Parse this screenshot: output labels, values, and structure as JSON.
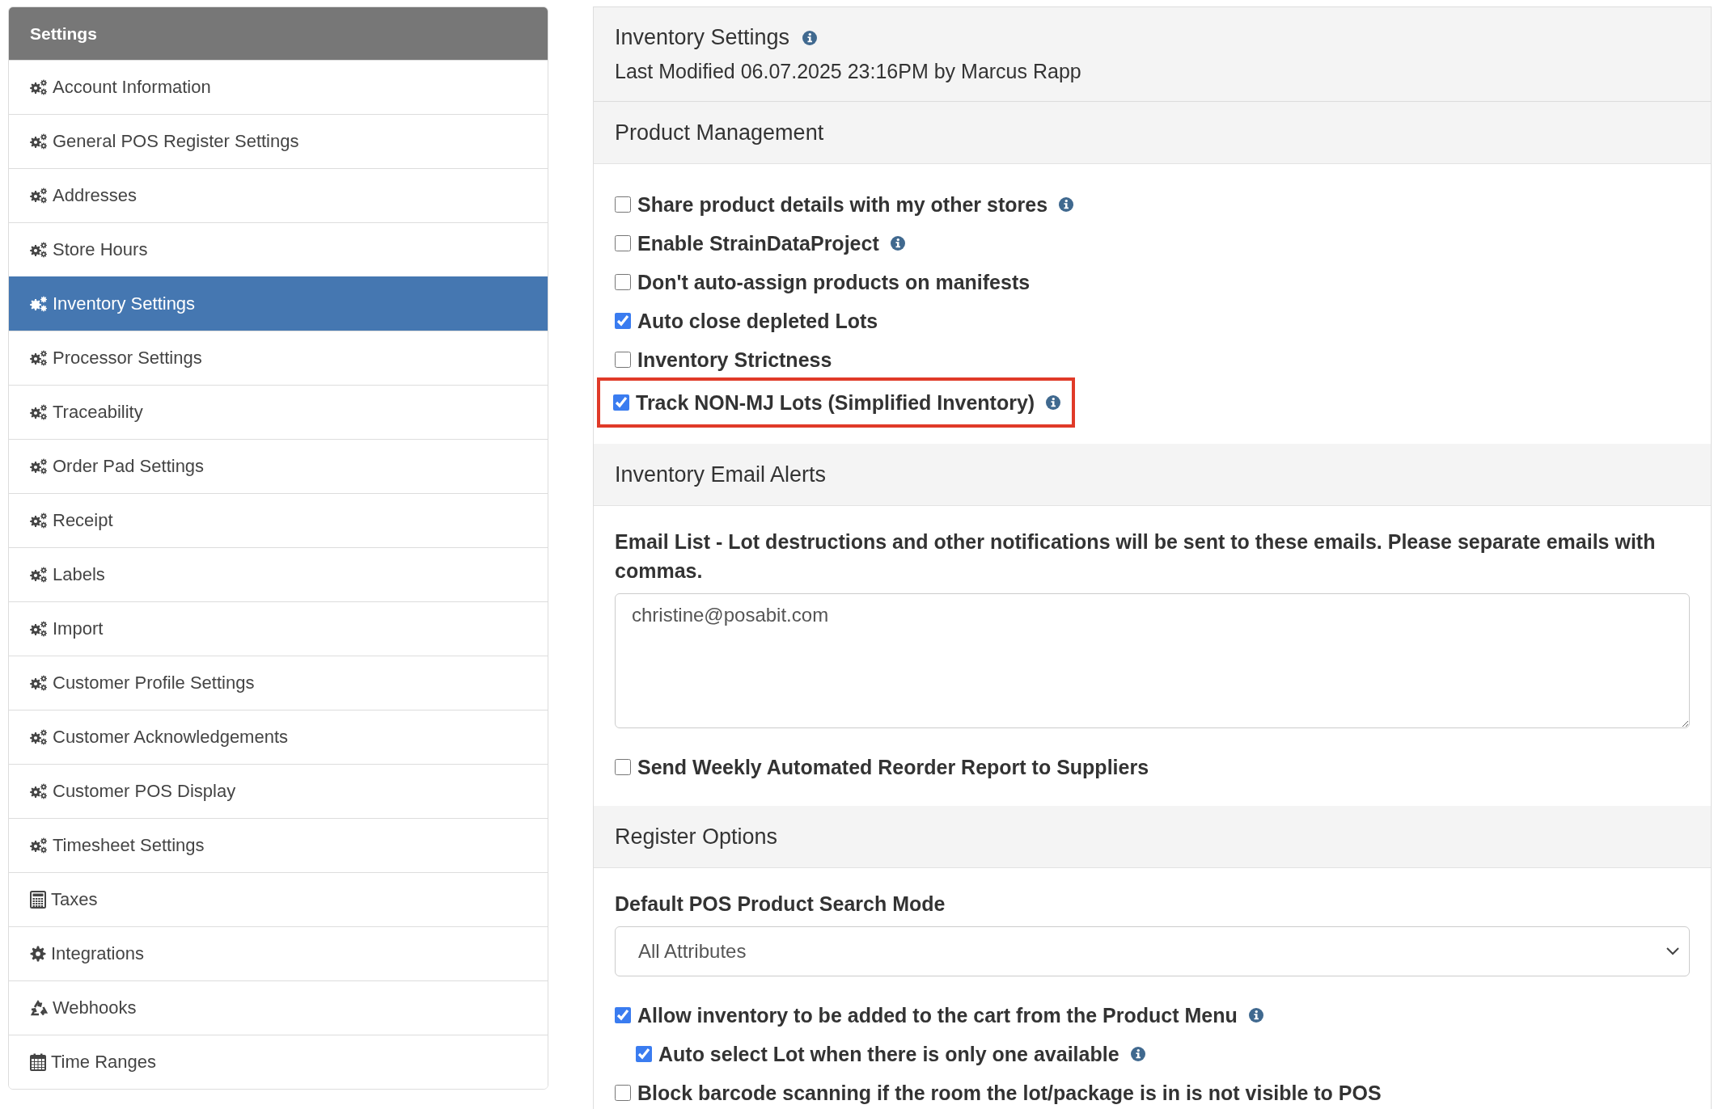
{
  "sidebar": {
    "title": "Settings",
    "items": [
      {
        "label": "Account Information",
        "kind": "gears",
        "selected": false
      },
      {
        "label": "General POS Register Settings",
        "kind": "gears",
        "selected": false
      },
      {
        "label": "Addresses",
        "kind": "gears",
        "selected": false
      },
      {
        "label": "Store Hours",
        "kind": "gears",
        "selected": false
      },
      {
        "label": "Inventory Settings",
        "kind": "gears",
        "selected": true
      },
      {
        "label": "Processor Settings",
        "kind": "gears",
        "selected": false
      },
      {
        "label": "Traceability",
        "kind": "gears",
        "selected": false
      },
      {
        "label": "Order Pad Settings",
        "kind": "gears",
        "selected": false
      },
      {
        "label": "Receipt",
        "kind": "gears",
        "selected": false
      },
      {
        "label": "Labels",
        "kind": "gears",
        "selected": false
      },
      {
        "label": "Import",
        "kind": "gears",
        "selected": false
      },
      {
        "label": "Customer Profile Settings",
        "kind": "gears",
        "selected": false
      },
      {
        "label": "Customer Acknowledgements",
        "kind": "gears",
        "selected": false
      },
      {
        "label": "Customer POS Display",
        "kind": "gears",
        "selected": false
      },
      {
        "label": "Timesheet Settings",
        "kind": "gears",
        "selected": false
      },
      {
        "label": "Taxes",
        "kind": "calculator",
        "selected": false
      },
      {
        "label": "Integrations",
        "kind": "gear",
        "selected": false
      },
      {
        "label": "Webhooks",
        "kind": "recycle",
        "selected": false
      },
      {
        "label": "Time Ranges",
        "kind": "calendar",
        "selected": false
      }
    ]
  },
  "panel": {
    "title": "Inventory Settings",
    "info": true,
    "modified": "Last Modified 06.07.2025 23:16PM by Marcus Rapp"
  },
  "sections": [
    {
      "title": "Product Management",
      "fields": [
        {
          "kind": "checkbox",
          "label": "Share product details with my other stores",
          "checked": false,
          "info": true,
          "highlighted": false
        },
        {
          "kind": "checkbox",
          "label": "Enable StrainDataProject",
          "checked": false,
          "info": true,
          "highlighted": false
        },
        {
          "kind": "checkbox",
          "label": "Don't auto-assign products on manifests",
          "checked": false,
          "info": false,
          "highlighted": false
        },
        {
          "kind": "checkbox",
          "label": "Auto close depleted Lots",
          "checked": true,
          "info": false,
          "highlighted": false
        },
        {
          "kind": "checkbox",
          "label": "Inventory Strictness",
          "checked": false,
          "info": false,
          "highlighted": false
        },
        {
          "kind": "checkbox",
          "label": "Track NON-MJ Lots (Simplified Inventory)",
          "checked": true,
          "info": true,
          "highlighted": true
        }
      ]
    },
    {
      "title": "Inventory Email Alerts",
      "fields": [
        {
          "kind": "textarea",
          "label": "Email List - Lot destructions and other notifications will be sent to these emails. Please separate emails with commas.",
          "value": "christine@posabit.com"
        },
        {
          "kind": "checkbox",
          "label": "Send Weekly Automated Reorder Report to Suppliers",
          "checked": false,
          "info": false,
          "highlighted": false
        }
      ]
    },
    {
      "title": "Register Options",
      "fields": [
        {
          "kind": "select",
          "label": "Default POS Product Search Mode",
          "value": "All Attributes"
        },
        {
          "kind": "checkbox",
          "label": "Allow inventory to be added to the cart from the Product Menu",
          "checked": true,
          "info": true,
          "highlighted": false,
          "children": [
            {
              "kind": "checkbox",
              "label": "Auto select Lot when there is only one available",
              "checked": true,
              "info": true,
              "highlighted": false
            }
          ]
        },
        {
          "kind": "checkbox",
          "label": "Block barcode scanning if the room the lot/package is in is not visible to POS",
          "checked": false,
          "info": false,
          "highlighted": false
        }
      ]
    }
  ]
}
